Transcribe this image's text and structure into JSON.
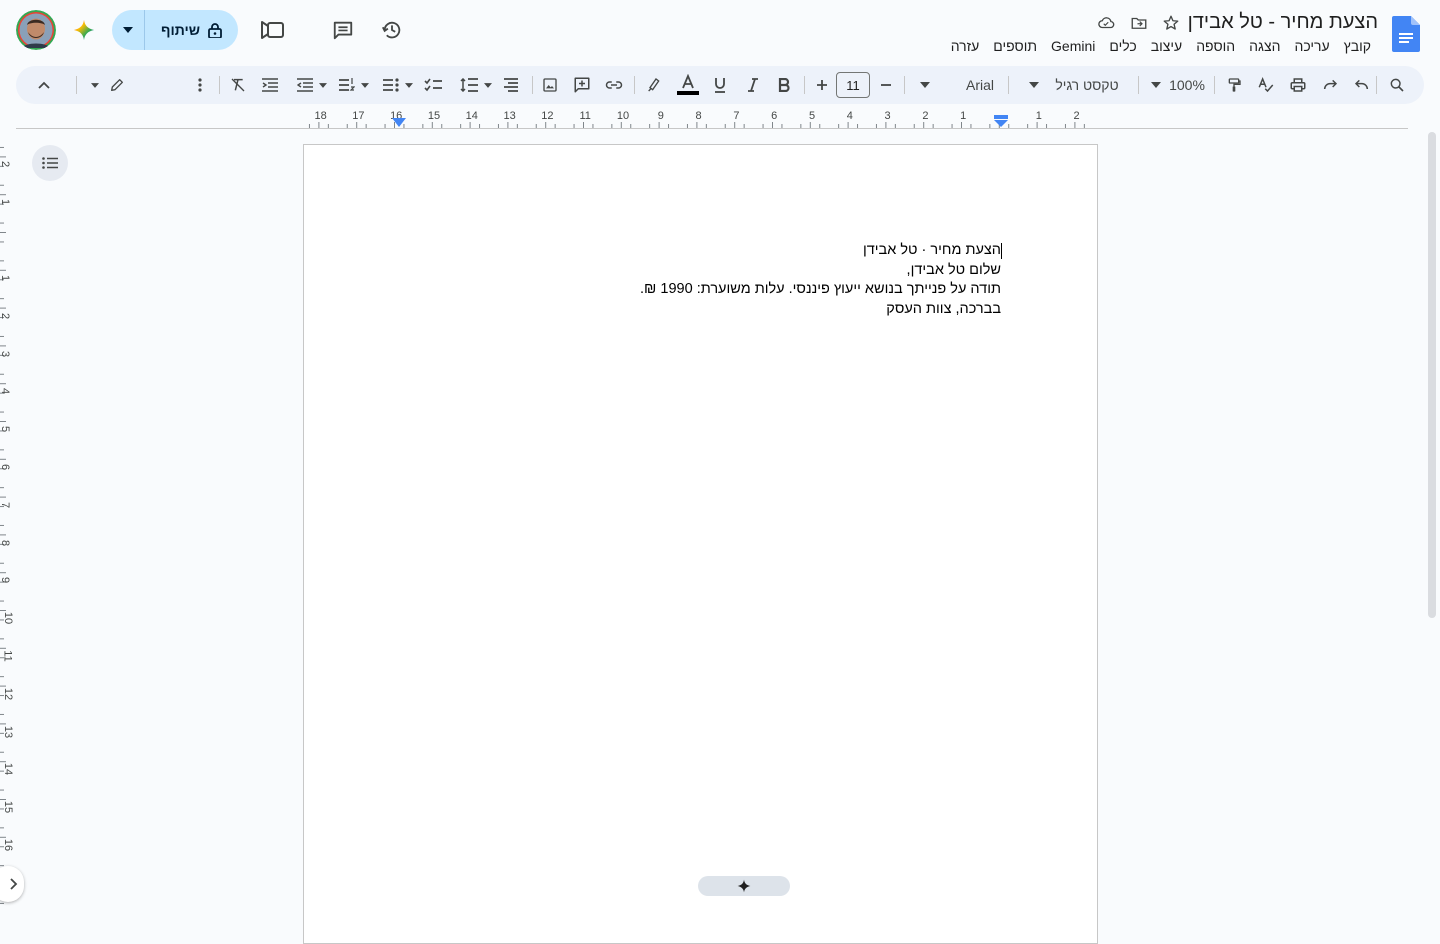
{
  "header": {
    "doc_title": "הצעת מחיר - טל אבידן",
    "menu": [
      "קובץ",
      "עריכה",
      "הצגה",
      "הוספה",
      "עיצוב",
      "כלים",
      "Gemini",
      "תוספים",
      "עזרה"
    ],
    "share_label": "שיתוף"
  },
  "toolbar": {
    "zoom": "100%",
    "style": "טקסט רגיל",
    "font": "Arial",
    "font_size": "11"
  },
  "ruler": {
    "h_numbers": [
      "2",
      "1",
      "1",
      "2",
      "3",
      "4",
      "5",
      "6",
      "7",
      "8",
      "9",
      "10",
      "11",
      "12",
      "13",
      "14",
      "15",
      "16",
      "17",
      "18"
    ],
    "v_numbers": [
      "2",
      "1",
      "1",
      "2",
      "3",
      "4",
      "5",
      "6",
      "7",
      "8",
      "9",
      "10",
      "11",
      "12",
      "13",
      "14",
      "15",
      "16"
    ]
  },
  "document": {
    "lines": [
      "הצעת מחיר · טל אבידן",
      "שלום טל אבידן,",
      "תודה על פנייתך בנושא ייעוץ פיננסי. עלות משוערת: 1990 ₪.",
      "בברכה, צוות העסק"
    ]
  },
  "colors": {
    "accent": "#0b57d0",
    "share_bg": "#c2e7ff",
    "toolbar_bg": "#edf2fa"
  }
}
